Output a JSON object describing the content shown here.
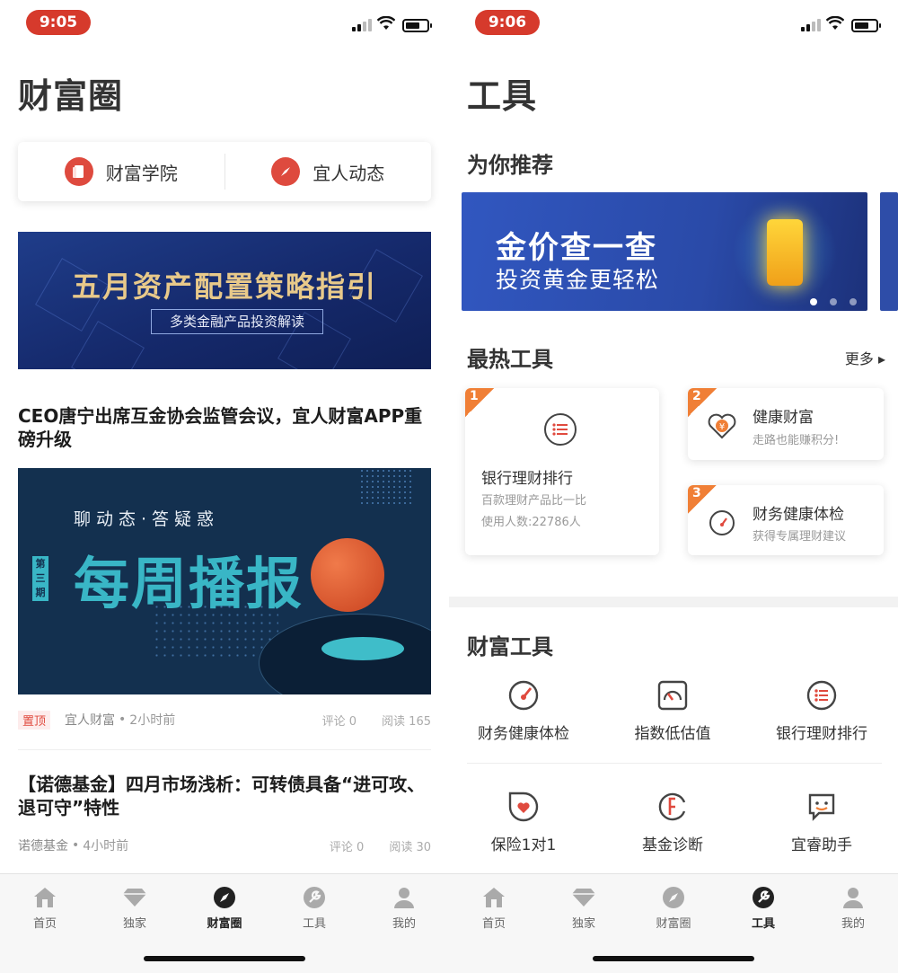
{
  "left": {
    "status": {
      "time": "9:05"
    },
    "title": "财富圈",
    "quick": [
      {
        "label": "财富学院",
        "icon": "book-icon"
      },
      {
        "label": "宜人动态",
        "icon": "compass-icon"
      }
    ],
    "banner1": {
      "title": "五月资产配置策略指引",
      "subtitle": "多类金融产品投资解读"
    },
    "article1": {
      "headline": "CEO唐宁出席互金协会监管会议，宜人财富APP重磅升级"
    },
    "banner2": {
      "subtitle": "聊动态·答疑惑",
      "title": "每周播报",
      "issue": "第三期"
    },
    "meta1": {
      "pin": "置顶",
      "source": "宜人财富",
      "time": "2小时前",
      "comments": "评论 0",
      "reads": "阅读 165"
    },
    "article2": {
      "headline": "【诺德基金】四月市场浅析：可转债具备“进可攻、退可守”特性"
    },
    "meta2": {
      "source": "诺德基金",
      "time": "4小时前",
      "comments": "评论 0",
      "reads": "阅读 30"
    }
  },
  "right": {
    "status": {
      "time": "9:06"
    },
    "title": "工具",
    "recommend_title": "为你推荐",
    "banner3": {
      "title": "金价查一查",
      "subtitle": "投资黄金更轻松"
    },
    "hot_title": "最热工具",
    "more_label": "更多 ▸",
    "hot": [
      {
        "rank": "1",
        "name": "银行理财排行",
        "desc": "百款理财产品比一比",
        "extra": "使用人数:22786人",
        "icon": "list-icon"
      },
      {
        "rank": "2",
        "name": "健康财富",
        "desc": "走路也能赚积分!",
        "icon": "heart-yen-icon"
      },
      {
        "rank": "3",
        "name": "财务健康体检",
        "desc": "获得专属理财建议",
        "icon": "gauge-icon"
      }
    ],
    "wealth_title": "财富工具",
    "tools": [
      {
        "label": "财务健康体检",
        "icon": "gauge-icon"
      },
      {
        "label": "指数低估值",
        "icon": "meter-icon"
      },
      {
        "label": "银行理财排行",
        "icon": "list-icon"
      },
      {
        "label": "保险1对1",
        "icon": "shield-heart-icon"
      },
      {
        "label": "基金诊断",
        "icon": "fund-icon"
      },
      {
        "label": "宜睿助手",
        "icon": "assistant-icon"
      }
    ]
  },
  "tabbar": {
    "tabs": [
      {
        "label": "首页",
        "icon": "home-icon"
      },
      {
        "label": "独家",
        "icon": "diamond-icon"
      },
      {
        "label": "财富圈",
        "icon": "compass-icon"
      },
      {
        "label": "工具",
        "icon": "wrench-icon"
      },
      {
        "label": "我的",
        "icon": "person-icon"
      }
    ],
    "left_active": "财富圈",
    "right_active": "工具"
  },
  "colors": {
    "accent": "#d63a2c",
    "rank": "#f07f36",
    "tool_blue": "#3157c0"
  }
}
